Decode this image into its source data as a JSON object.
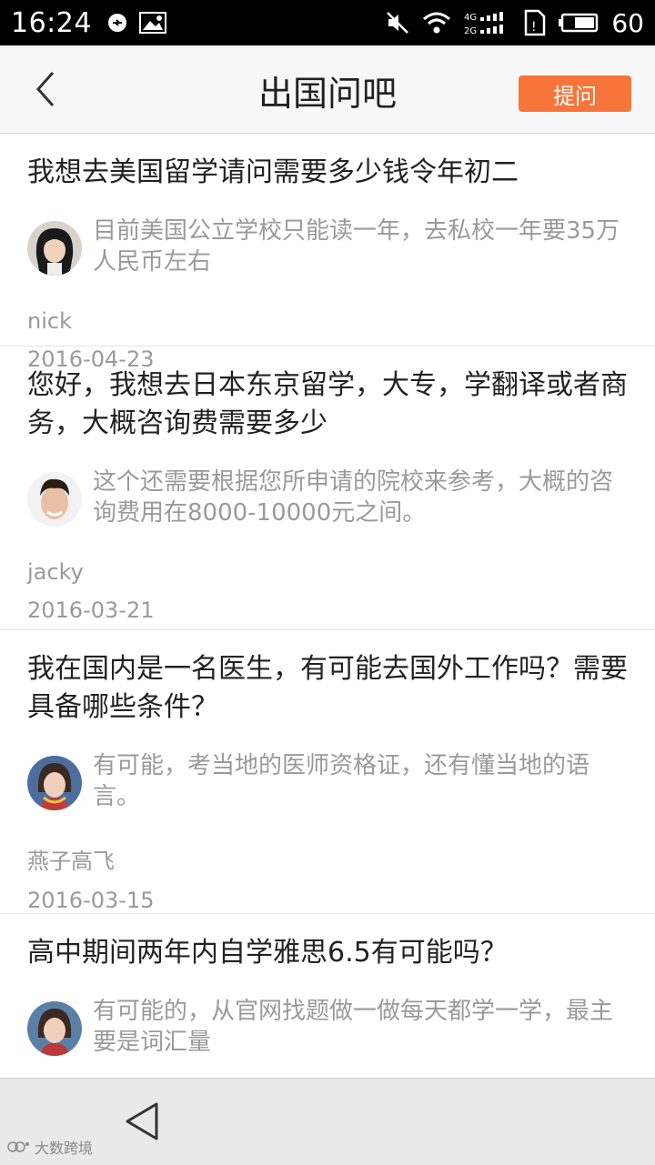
{
  "status_bar": {
    "time": "16:24",
    "battery": "60",
    "icons": [
      "sync-icon",
      "image-icon",
      "mute-icon",
      "wifi-icon",
      "signal-4g-icon",
      "sim-icon",
      "battery-icon"
    ]
  },
  "header": {
    "title": "出国问吧",
    "ask_button": "提问"
  },
  "colors": {
    "accent": "#f7753a",
    "muted_text": "#9a9a9a"
  },
  "items": [
    {
      "question": "我想去美国留学请问需要多少钱令年初二",
      "answer": "目前美国公立学校只能读一年，去私校一年要35万人民币左右",
      "author": "nick",
      "date": "2016-04-23"
    },
    {
      "question": "您好，我想去日本东京留学，大专，学翻译或者商务，大概咨询费需要多少",
      "answer": "这个还需要根据您所申请的院校来参考，大概的咨询费用在8000-10000元之间。",
      "author": "jacky",
      "date": "2016-03-21"
    },
    {
      "question": "我在国内是一名医生，有可能去国外工作吗？需要具备哪些条件？",
      "answer": "有可能，考当地的医师资格证，还有懂当地的语言。",
      "author": "燕子高飞",
      "date": "2016-03-15"
    },
    {
      "question": "高中期间两年内自学雅思6.5有可能吗？",
      "answer": "有可能的，从官网找题做一做每天都学一学，最主要是词汇量",
      "author": "",
      "date": ""
    }
  ],
  "watermark": "大数跨境"
}
